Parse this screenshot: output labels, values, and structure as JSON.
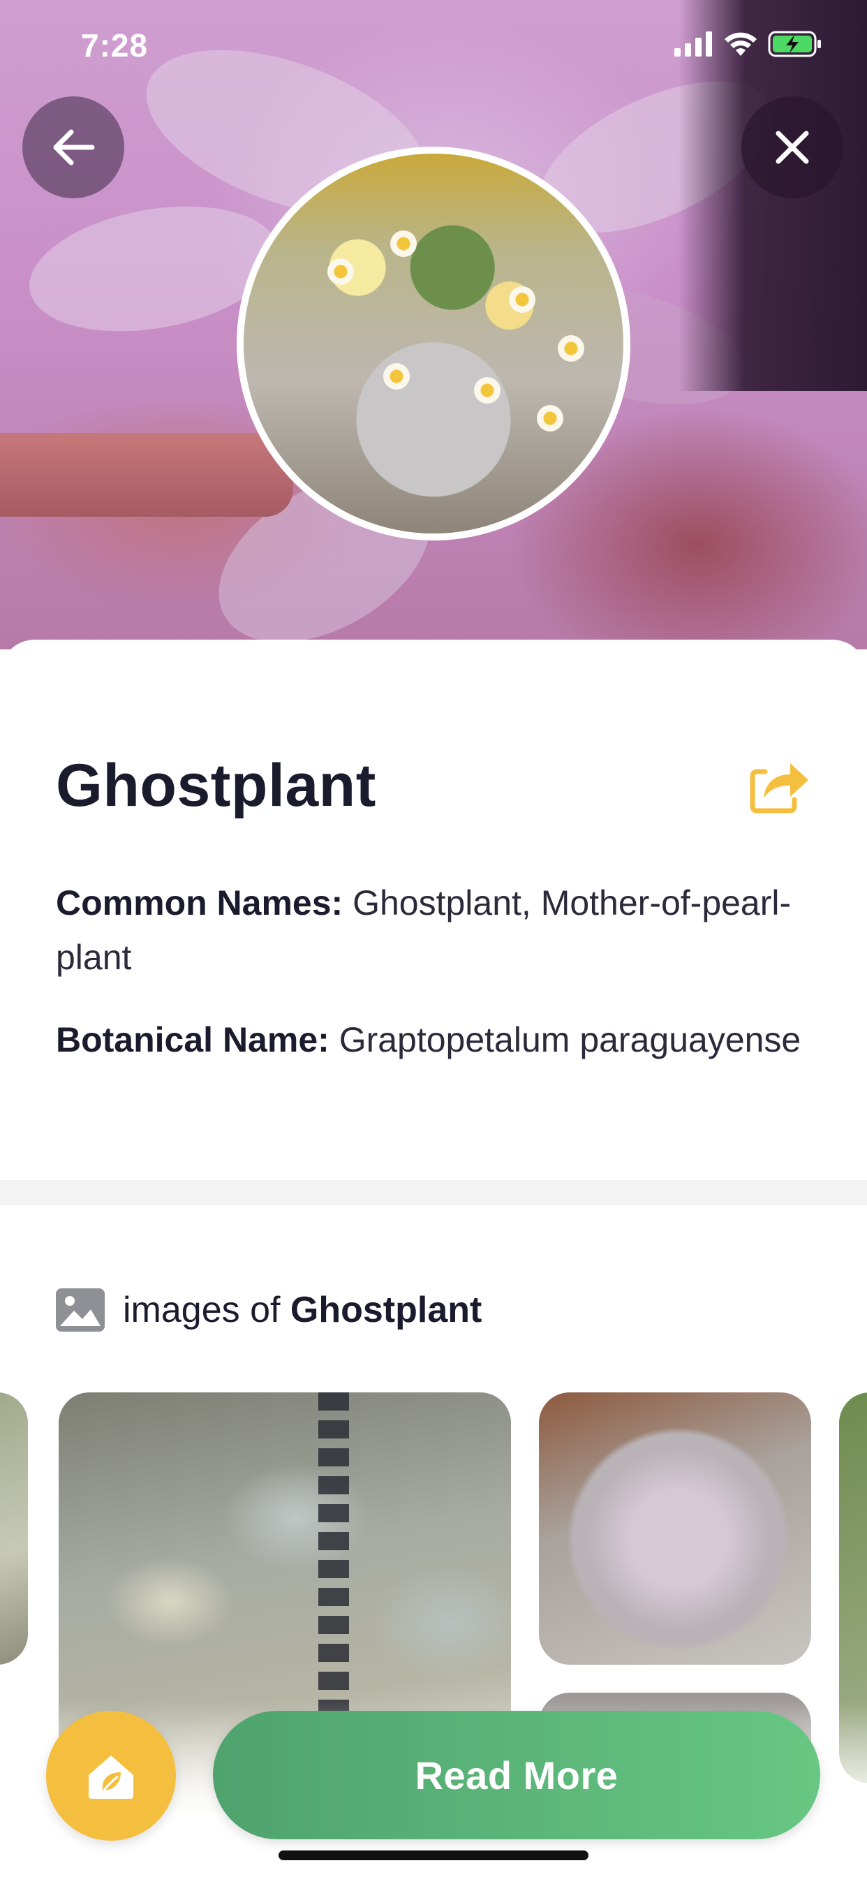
{
  "status_bar": {
    "time": "7:28"
  },
  "plant": {
    "title": "Ghostplant",
    "common_names_label": "Common Names:",
    "common_names_value": "Ghostplant, Mother-of-pearl-plant",
    "botanical_name_label": "Botanical Name:",
    "botanical_name_value": "Graptopetalum paraguayense"
  },
  "images_section": {
    "prefix": "images of",
    "plant_name": "Ghostplant"
  },
  "actions": {
    "read_more_label": "Read More"
  },
  "colors": {
    "accent_green": "#5cb87a",
    "accent_yellow": "#f4bf3e",
    "title_text": "#1b1b2e"
  },
  "icons": [
    "back-arrow-icon",
    "close-icon",
    "share-icon",
    "image-icon",
    "garden-icon",
    "signal-icon",
    "wifi-icon",
    "battery-charging-icon"
  ]
}
